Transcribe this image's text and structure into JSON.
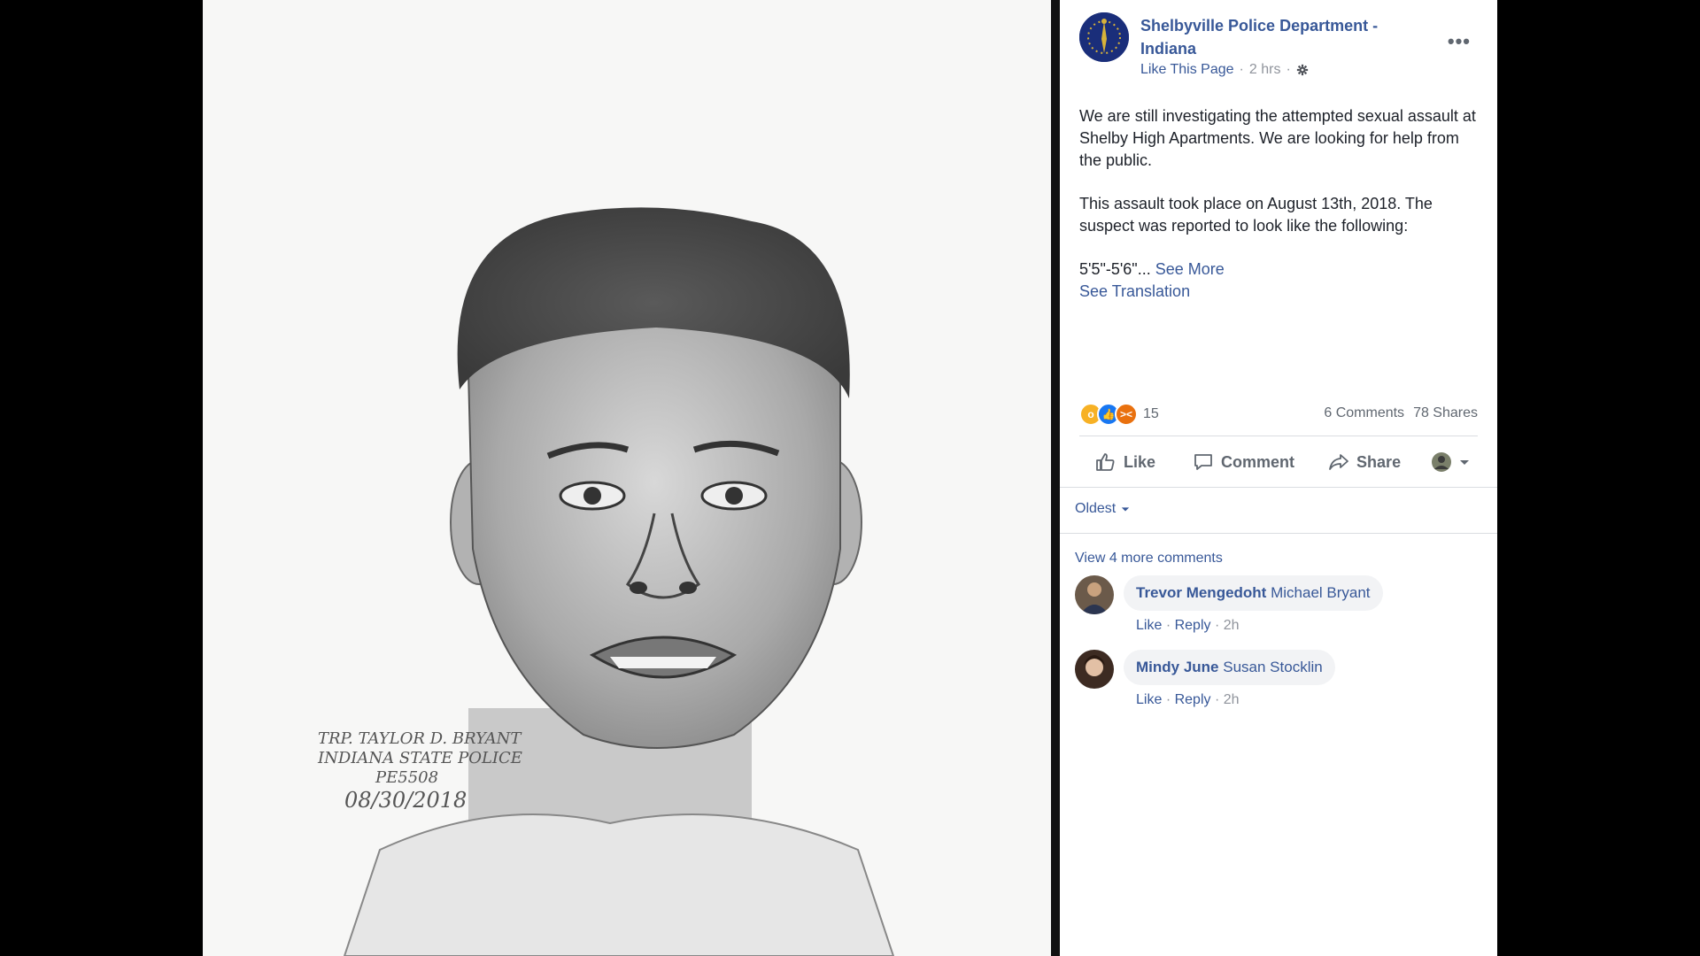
{
  "photo": {
    "signature_lines": [
      "TRP. TAYLOR D. BRYANT",
      "INDIANA STATE POLICE",
      "PE5508",
      "08/30/2018"
    ]
  },
  "post": {
    "page_name": "Shelbyville Police Department - Indiana",
    "like_page": "Like This Page",
    "time": "2 hrs",
    "more_icon": "ellipsis-icon",
    "paragraph1": "We are still investigating the attempted sexual assault at Shelby High Apartments. We are looking for help from the public.",
    "paragraph2": "This assault took place on August 13th, 2018. The suspect was reported to look like the following:",
    "paragraph3": "5'5\"-5'6\"...",
    "see_more": "See More",
    "see_translation": "See Translation"
  },
  "stats": {
    "reaction_count": "15",
    "comments": "6 Comments",
    "shares": "78 Shares",
    "reaction_colors": {
      "wow": "#f7b125",
      "like": "#1877f2",
      "angry": "#e9710f"
    }
  },
  "actions": {
    "like": "Like",
    "comment": "Comment",
    "share": "Share"
  },
  "comments_section": {
    "sort": "Oldest",
    "view_more": "View 4 more comments",
    "items": [
      {
        "author": "Trevor Mengedoht",
        "tag": "Michael Bryant",
        "like": "Like",
        "reply": "Reply",
        "time": "2h"
      },
      {
        "author": "Mindy June",
        "tag": "Susan Stocklin",
        "like": "Like",
        "reply": "Reply",
        "time": "2h"
      }
    ]
  },
  "colors": {
    "link": "#385898",
    "muted": "#90949c",
    "text": "#1d2129"
  }
}
